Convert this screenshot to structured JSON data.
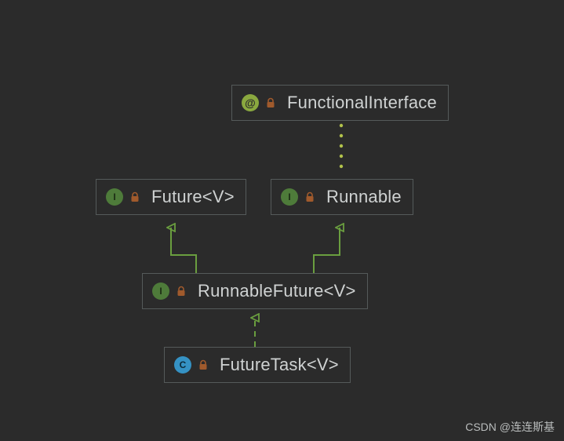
{
  "nodes": {
    "functionalInterface": {
      "label": "FunctionalInterface",
      "kind": "annotation"
    },
    "future": {
      "label": "Future<V>",
      "kind": "interface"
    },
    "runnable": {
      "label": "Runnable",
      "kind": "interface"
    },
    "runnableFuture": {
      "label": "RunnableFuture<V>",
      "kind": "interface"
    },
    "futureTask": {
      "label": "FutureTask<V>",
      "kind": "class"
    }
  },
  "edges": [
    {
      "from": "runnableFuture",
      "to": "future",
      "style": "solid",
      "relation": "extends"
    },
    {
      "from": "runnableFuture",
      "to": "runnable",
      "style": "solid",
      "relation": "extends"
    },
    {
      "from": "futureTask",
      "to": "runnableFuture",
      "style": "dashed",
      "relation": "implements"
    },
    {
      "from": "runnable",
      "to": "functionalInterface",
      "style": "dotted",
      "relation": "annotated"
    }
  ],
  "watermark": "CSDN @连连斯基",
  "colors": {
    "background": "#2b2b2b",
    "border": "#555a5a",
    "text": "#cfd2d2",
    "edge": "#6a9e3f",
    "dotted": "#b2c24b",
    "interfaceBadge": "#4e7b3a",
    "annotationBadge": "#8aa83f",
    "classBadge": "#3592c4",
    "lock": "#a05a2c"
  }
}
